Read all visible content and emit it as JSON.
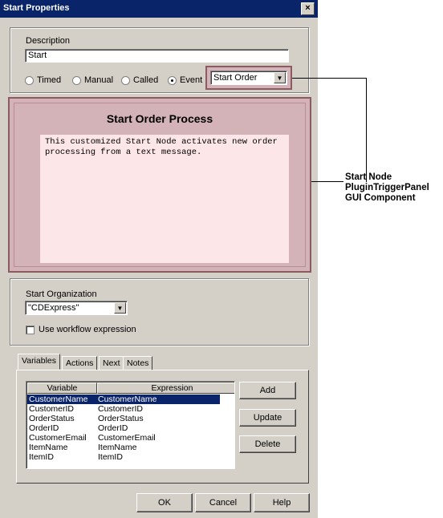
{
  "window": {
    "title": "Start Properties",
    "close_symbol": "×"
  },
  "description": {
    "label": "Description",
    "value": "Start"
  },
  "start_type": {
    "options": [
      "Timed",
      "Manual",
      "Called",
      "Event"
    ],
    "selected": "Event",
    "event_select_value": "Start Order"
  },
  "plugin_panel": {
    "title": "Start Order Process",
    "text_line1": "This customized Start Node activates new order",
    "text_line2": "processing from a text message."
  },
  "organization": {
    "label": "Start Organization",
    "value": "\"CDExpress\"",
    "checkbox_label": "Use workflow expression"
  },
  "tabs": [
    "Variables",
    "Actions",
    "Next",
    "Notes"
  ],
  "active_tab": "Variables",
  "table": {
    "columns": [
      "Variable",
      "Expression"
    ],
    "rows": [
      {
        "variable": "CustomerName",
        "expression": "CustomerName",
        "selected": true
      },
      {
        "variable": "CustomerID",
        "expression": "CustomerID"
      },
      {
        "variable": "OrderStatus",
        "expression": "OrderStatus"
      },
      {
        "variable": "OrderID",
        "expression": "OrderID"
      },
      {
        "variable": "CustomerEmail",
        "expression": "CustomerEmail"
      },
      {
        "variable": "ItemName",
        "expression": "ItemName"
      },
      {
        "variable": "ItemID",
        "expression": "ItemID"
      }
    ]
  },
  "side_buttons": {
    "add": "Add",
    "update": "Update",
    "delete": "Delete"
  },
  "footer_buttons": {
    "ok": "OK",
    "cancel": "Cancel",
    "help": "Help"
  },
  "annotation": {
    "line1": "Start Node",
    "line2": "PluginTriggerPanel",
    "line3": "GUI Component"
  },
  "icons": {
    "dropdown": "chevron-down-icon",
    "scroll_up": "arrow-up-icon",
    "scroll_down": "arrow-down-icon"
  }
}
